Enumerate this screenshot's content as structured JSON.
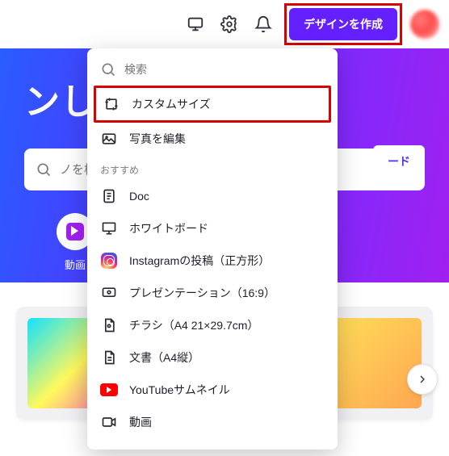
{
  "topbar": {
    "create_label": "デザインを作成"
  },
  "hero": {
    "title_fragment": "ンしま",
    "search_placeholder_fragment": "ノを検索",
    "upgrade_fragment": "ード",
    "card_video_label": "動画"
  },
  "dropdown": {
    "search_placeholder": "検索",
    "custom_size": "カスタムサイズ",
    "edit_photo": "写真を編集",
    "section_recommended": "おすすめ",
    "items": {
      "doc": "Doc",
      "whiteboard": "ホワイトボード",
      "instagram": "Instagramの投稿（正方形）",
      "presentation": "プレゼンテーション（16:9）",
      "flyer": "チラシ（A4 21×29.7cm）",
      "document": "文書（A4縦）",
      "youtube": "YouTubeサムネイル",
      "video": "動画"
    }
  }
}
